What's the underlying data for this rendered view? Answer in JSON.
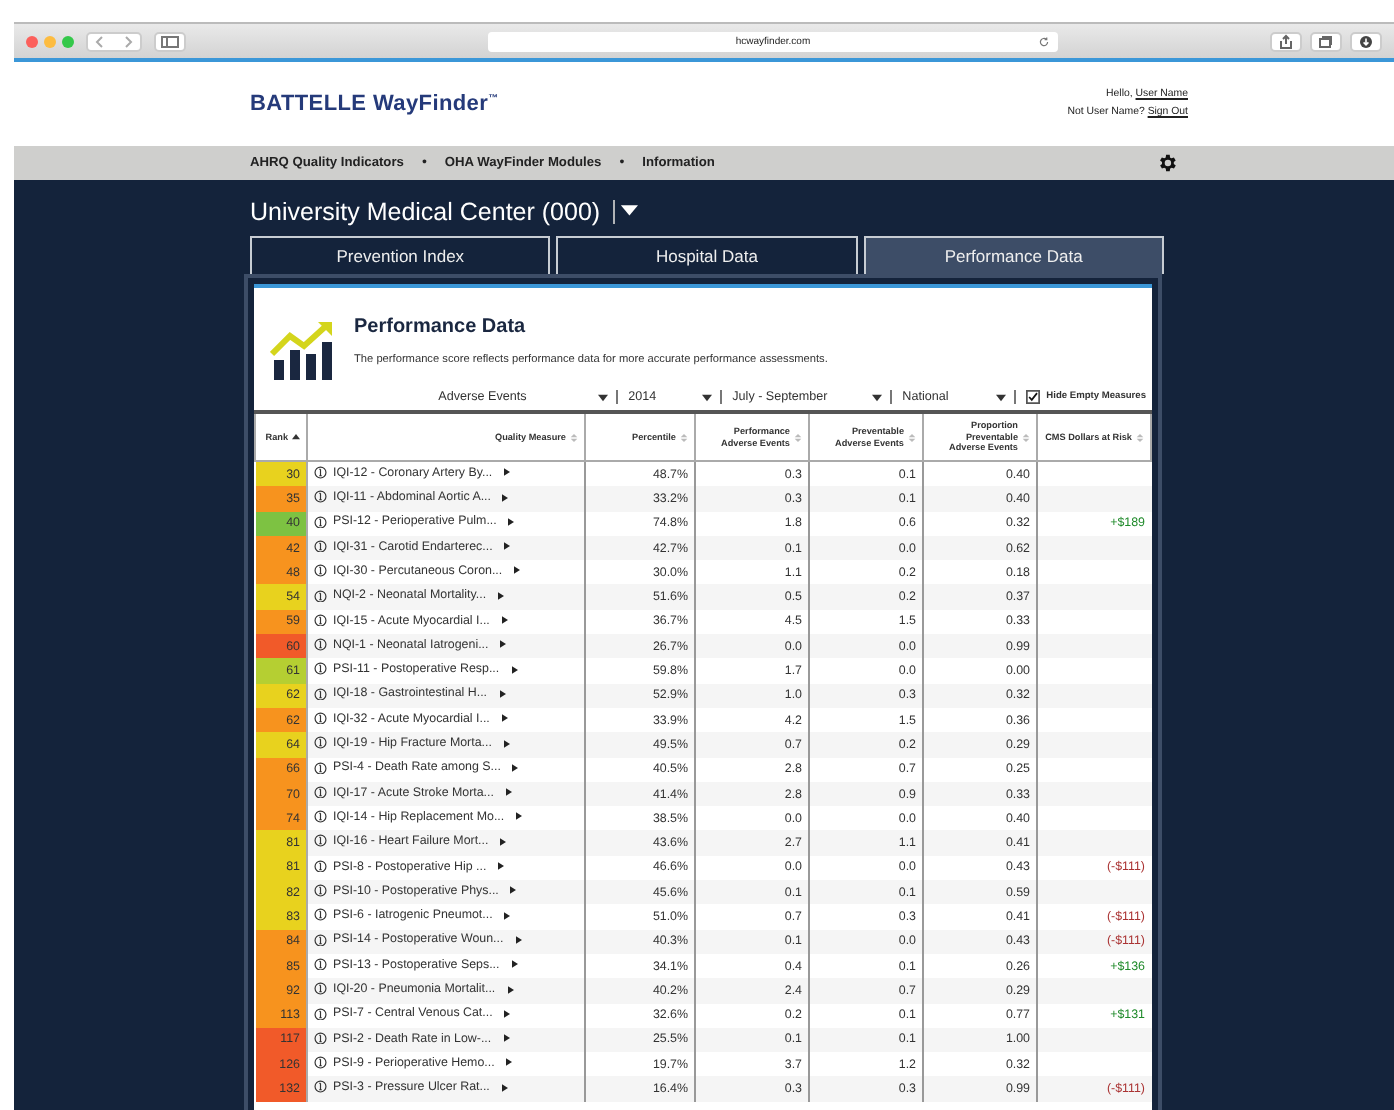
{
  "browser": {
    "url": "hcwayfinder.com"
  },
  "header": {
    "logo": "BATTELLE WayFinder$^{™}$",
    "greeting": "Hello,",
    "user_link": "User Name",
    "not_user": "Not User Name?",
    "sign_out": "Sign Out"
  },
  "nav": [
    {
      "kind": "link",
      "label": "AHRQ Quality Indicators"
    },
    {
      "kind": "bullet",
      "label": "•"
    },
    {
      "kind": "link",
      "label": "OHA WayFinder Modules"
    },
    {
      "kind": "bullet",
      "label": "•"
    },
    {
      "kind": "link",
      "label": "Information"
    }
  ],
  "facility": {
    "name": "University Medical Center (000)"
  },
  "tabs": [
    {
      "label": "Prevention Index",
      "selected": false
    },
    {
      "label": "Hospital Data",
      "selected": false
    },
    {
      "label": "Performance Data",
      "selected": true
    }
  ],
  "panel": {
    "title": "Performance Data",
    "description": "The performance score reflects performance data for more accurate performance assessments."
  },
  "filters": [
    {
      "value": "Adverse Events"
    },
    {
      "value": "2014"
    },
    {
      "value": "July - September"
    },
    {
      "value": "National"
    }
  ],
  "hide_empty": {
    "label": "Hide Empty Measures",
    "checked": true
  },
  "table": {
    "columns": [
      {
        "label": "Rank",
        "sorted": true
      },
      {
        "label": "Quality Measure",
        "sorted": false
      },
      {
        "label": "Percentile",
        "sorted": false
      },
      {
        "label": "Performance Adverse Events",
        "sorted": false
      },
      {
        "label": "Preventable Adverse Events",
        "sorted": false
      },
      {
        "label": "Proportion Preventable Adverse Events",
        "sorted": false
      },
      {
        "label": "CMS Dollars at Risk",
        "sorted": false
      }
    ],
    "rows": [
      {
        "rank": "30",
        "color": "#e8d21e",
        "measure": "IQI-12 - Coronary Artery By...",
        "percentile": "48.7%",
        "performance": "0.3",
        "preventable": "0.1",
        "proportion": "0.40"
      },
      {
        "rank": "35",
        "color": "#f7931e",
        "measure": "IQI-11 - Abdominal Aortic A...",
        "percentile": "33.2%",
        "performance": "0.3",
        "preventable": "0.1",
        "proportion": "0.40"
      },
      {
        "rank": "40",
        "color": "#7dc242",
        "measure": "PSI-12 - Perioperative Pulm...",
        "percentile": "74.8%",
        "performance": "1.8",
        "preventable": "0.6",
        "proportion": "0.32",
        "cms": "+$189",
        "gain": true
      },
      {
        "rank": "42",
        "color": "#f7931e",
        "measure": "IQI-31 - Carotid Endarterec...",
        "percentile": "42.7%",
        "performance": "0.1",
        "preventable": "0.0",
        "proportion": "0.62"
      },
      {
        "rank": "48",
        "color": "#f7931e",
        "measure": "IQI-30 - Percutaneous Coron...",
        "percentile": "30.0%",
        "performance": "1.1",
        "preventable": "0.2",
        "proportion": "0.18"
      },
      {
        "rank": "54",
        "color": "#e8d21e",
        "measure": "NQI-2 - Neonatal Mortality...",
        "percentile": "51.6%",
        "performance": "0.5",
        "preventable": "0.2",
        "proportion": "0.37"
      },
      {
        "rank": "59",
        "color": "#f7931e",
        "measure": "IQI-15 - Acute Myocardial I...",
        "percentile": "36.7%",
        "performance": "4.5",
        "preventable": "1.5",
        "proportion": "0.33"
      },
      {
        "rank": "60",
        "color": "#f15a29",
        "measure": "NQI-1 - Neonatal Iatrogeni...",
        "percentile": "26.7%",
        "performance": "0.0",
        "preventable": "0.0",
        "proportion": "0.99"
      },
      {
        "rank": "61",
        "color": "#b5cf32",
        "measure": "PSI-11 - Postoperative Resp...",
        "percentile": "59.8%",
        "performance": "1.7",
        "preventable": "0.0",
        "proportion": "0.00"
      },
      {
        "rank": "62",
        "color": "#e8d21e",
        "measure": "IQI-18 - Gastrointestinal H...",
        "percentile": "52.9%",
        "performance": "1.0",
        "preventable": "0.3",
        "proportion": "0.32"
      },
      {
        "rank": "62",
        "color": "#f7931e",
        "measure": "IQI-32 - Acute Myocardial I...",
        "percentile": "33.9%",
        "performance": "4.2",
        "preventable": "1.5",
        "proportion": "0.36"
      },
      {
        "rank": "64",
        "color": "#e8d21e",
        "measure": "IQI-19 - Hip Fracture Morta...",
        "percentile": "49.5%",
        "performance": "0.7",
        "preventable": "0.2",
        "proportion": "0.29"
      },
      {
        "rank": "66",
        "color": "#f7931e",
        "measure": "PSI-4 - Death Rate among S...",
        "percentile": "40.5%",
        "performance": "2.8",
        "preventable": "0.7",
        "proportion": "0.25"
      },
      {
        "rank": "70",
        "color": "#f7931e",
        "measure": "IQI-17 - Acute Stroke Morta...",
        "percentile": "41.4%",
        "performance": "2.8",
        "preventable": "0.9",
        "proportion": "0.33"
      },
      {
        "rank": "74",
        "color": "#f7931e",
        "measure": "IQI-14 - Hip Replacement Mo...",
        "percentile": "38.5%",
        "performance": "0.0",
        "preventable": "0.0",
        "proportion": "0.40"
      },
      {
        "rank": "81",
        "color": "#e8d21e",
        "measure": "IQI-16 - Heart Failure Mort...",
        "percentile": "43.6%",
        "performance": "2.7",
        "preventable": "1.1",
        "proportion": "0.41"
      },
      {
        "rank": "81",
        "color": "#e8d21e",
        "measure": "PSI-8 - Postoperative Hip ...",
        "percentile": "46.6%",
        "performance": "0.0",
        "preventable": "0.0",
        "proportion": "0.43",
        "cms": "(-$111)",
        "gain": false
      },
      {
        "rank": "82",
        "color": "#e8d21e",
        "measure": "PSI-10 - Postoperative Phys...",
        "percentile": "45.6%",
        "performance": "0.1",
        "preventable": "0.1",
        "proportion": "0.59"
      },
      {
        "rank": "83",
        "color": "#e8d21e",
        "measure": "PSI-6 - Iatrogenic Pneumot...",
        "percentile": "51.0%",
        "performance": "0.7",
        "preventable": "0.3",
        "proportion": "0.41",
        "cms": "(-$111)",
        "gain": false
      },
      {
        "rank": "84",
        "color": "#f7931e",
        "measure": "PSI-14 - Postoperative Woun...",
        "percentile": "40.3%",
        "performance": "0.1",
        "preventable": "0.0",
        "proportion": "0.43",
        "cms": "(-$111)",
        "gain": false
      },
      {
        "rank": "85",
        "color": "#f7931e",
        "measure": "PSI-13 - Postoperative Seps...",
        "percentile": "34.1%",
        "performance": "0.4",
        "preventable": "0.1",
        "proportion": "0.26",
        "cms": "+$136",
        "gain": true
      },
      {
        "rank": "92",
        "color": "#f7931e",
        "measure": "IQI-20 - Pneumonia Mortalit...",
        "percentile": "40.2%",
        "performance": "2.4",
        "preventable": "0.7",
        "proportion": "0.29"
      },
      {
        "rank": "113",
        "color": "#f7931e",
        "measure": "PSI-7 - Central Venous Cat...",
        "percentile": "32.6%",
        "performance": "0.2",
        "preventable": "0.1",
        "proportion": "0.77",
        "cms": "+$131",
        "gain": true
      },
      {
        "rank": "117",
        "color": "#f15a29",
        "measure": "PSI-2 - Death Rate in Low-...",
        "percentile": "25.5%",
        "performance": "0.1",
        "preventable": "0.1",
        "proportion": "1.00"
      },
      {
        "rank": "126",
        "color": "#f15a29",
        "measure": "PSI-9 - Perioperative Hemo...",
        "percentile": "19.7%",
        "performance": "3.7",
        "preventable": "1.2",
        "proportion": "0.32"
      },
      {
        "rank": "132",
        "color": "#f15a29",
        "measure": "PSI-3 - Pressure Ulcer Rat...",
        "percentile": "16.4%",
        "performance": "0.3",
        "preventable": "0.3",
        "proportion": "0.99",
        "cms": "(-$111)",
        "gain": false
      }
    ]
  }
}
